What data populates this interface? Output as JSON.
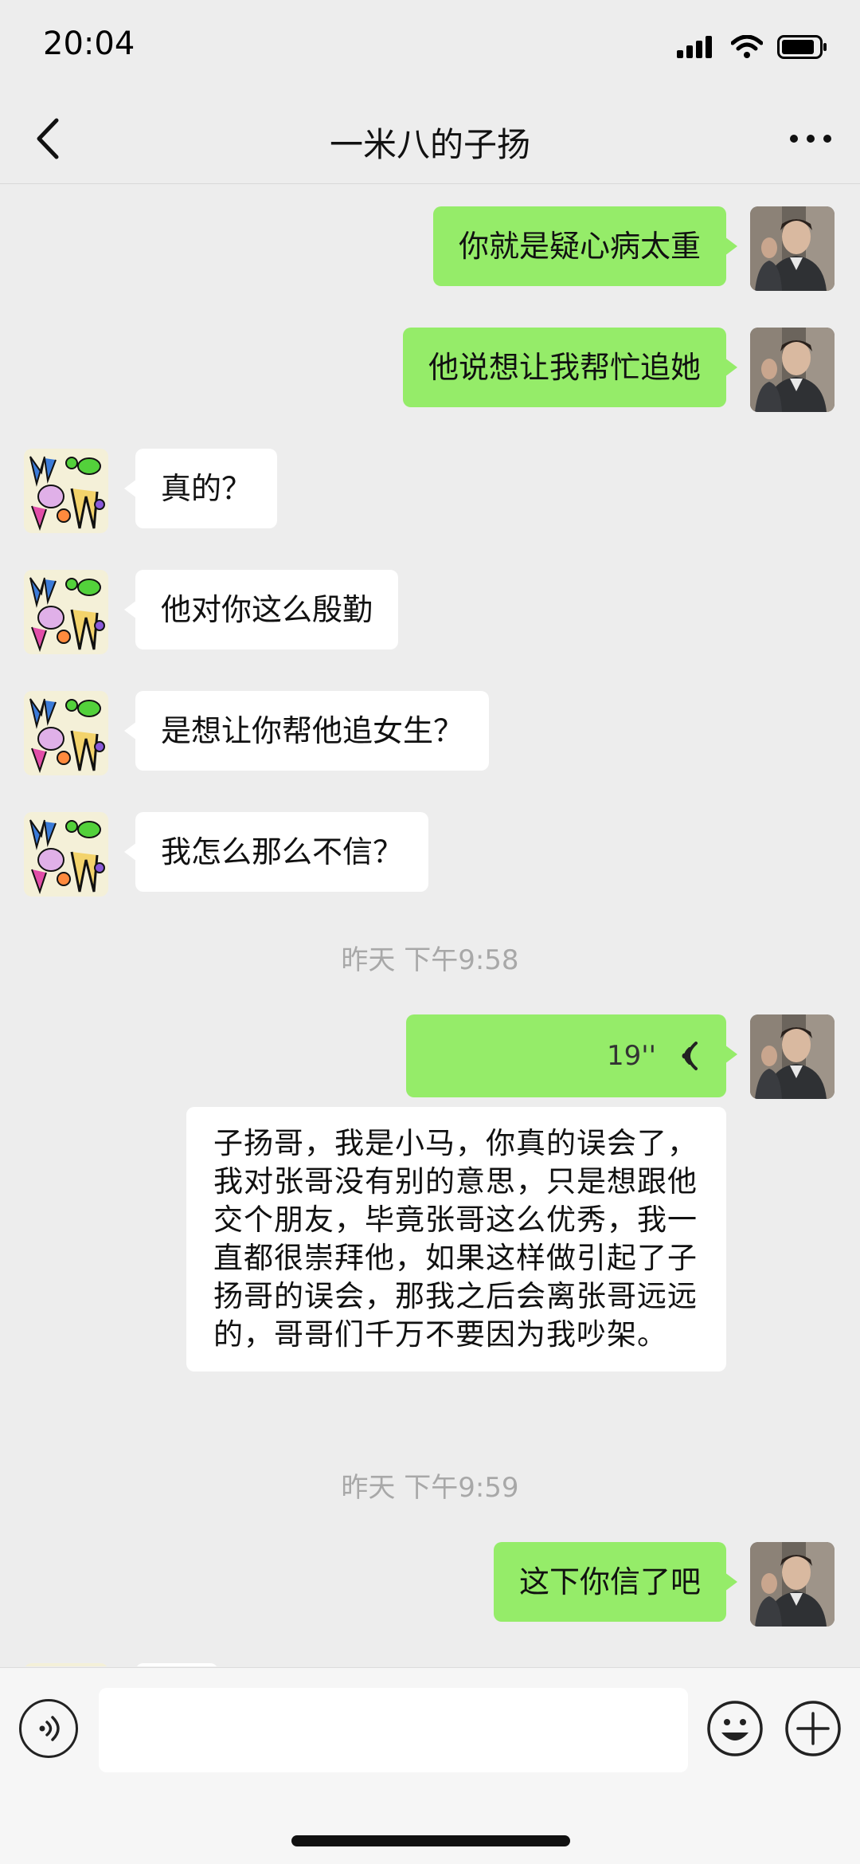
{
  "status": {
    "time": "20:04"
  },
  "nav": {
    "title": "一米八的子扬"
  },
  "messages": [
    {
      "side": "out",
      "text": "你就是疑心病太重"
    },
    {
      "side": "out",
      "text": "他说想让我帮忙追她"
    },
    {
      "side": "in",
      "text": "真的？"
    },
    {
      "side": "in",
      "text": "他对你这么殷勤"
    },
    {
      "side": "in",
      "text": "是想让你帮他追女生？"
    },
    {
      "side": "in",
      "text": "我怎么那么不信？"
    }
  ],
  "timestamps": [
    "昨天 下午9:58",
    "昨天 下午9:59"
  ],
  "voice_message": {
    "duration": "19''"
  },
  "transcript": "子扬哥，我是小马，你真的误会了，我对张哥没有别的意思，只是想跟他交个朋友，毕竟张哥这么优秀，我一直都很崇拜他，如果这样做引起了子扬哥的误会，那我之后会离张哥远远的，哥哥们千万不要因为我吵架。",
  "last_message": {
    "side": "out",
    "text": "这下你信了吧"
  },
  "colors": {
    "outgoing_bubble": "#95ec69",
    "incoming_bubble": "#ffffff",
    "background": "#ededed"
  }
}
